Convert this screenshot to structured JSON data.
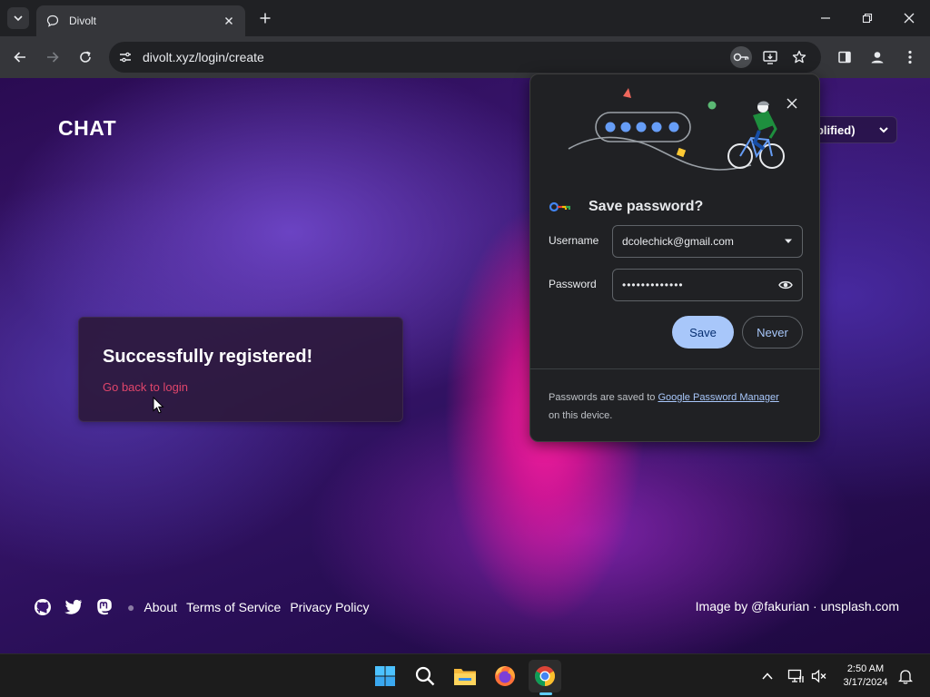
{
  "browser": {
    "tab_title": "Divolt",
    "url": "divolt.xyz/login/create"
  },
  "page": {
    "brand": "CHAT",
    "language_select": "nplified)",
    "card": {
      "title": "Successfully registered!",
      "link": "Go back to login"
    },
    "footer": {
      "links": [
        "About",
        "Terms of Service",
        "Privacy Policy"
      ],
      "credit": "Image by @fakurian · unsplash.com"
    }
  },
  "password_bubble": {
    "title": "Save password?",
    "username_label": "Username",
    "username_value": "dcolechick@gmail.com",
    "password_label": "Password",
    "password_value": "•••••••••••••",
    "save_button": "Save",
    "never_button": "Never",
    "footer_prefix": "Passwords are saved to ",
    "footer_link": "Google Password Manager",
    "footer_suffix": "on this device."
  },
  "taskbar": {
    "time": "2:50 AM",
    "date": "3/17/2024"
  },
  "icons": {
    "tab_search": "chevron-down-icon",
    "favicon": "chat-bubble-icon",
    "omnibox": [
      "key-icon",
      "install-app-icon",
      "star-icon"
    ],
    "toolbar_right": [
      "side-panel-icon",
      "profile-icon",
      "more-menu-icon"
    ],
    "social": [
      "github-icon",
      "twitter-icon",
      "mastodon-icon"
    ],
    "taskbar": [
      "windows-start-icon",
      "search-icon",
      "file-explorer-icon",
      "firefox-icon",
      "chrome-icon"
    ],
    "tray": [
      "chevron-up-icon",
      "network-icon",
      "volume-muted-icon",
      "notification-bell-icon"
    ]
  },
  "colors": {
    "accent_link": "#e0456b",
    "save_button_bg": "#a8c7fa",
    "chrome_dark": "#202124",
    "toolbar": "#35363a"
  }
}
